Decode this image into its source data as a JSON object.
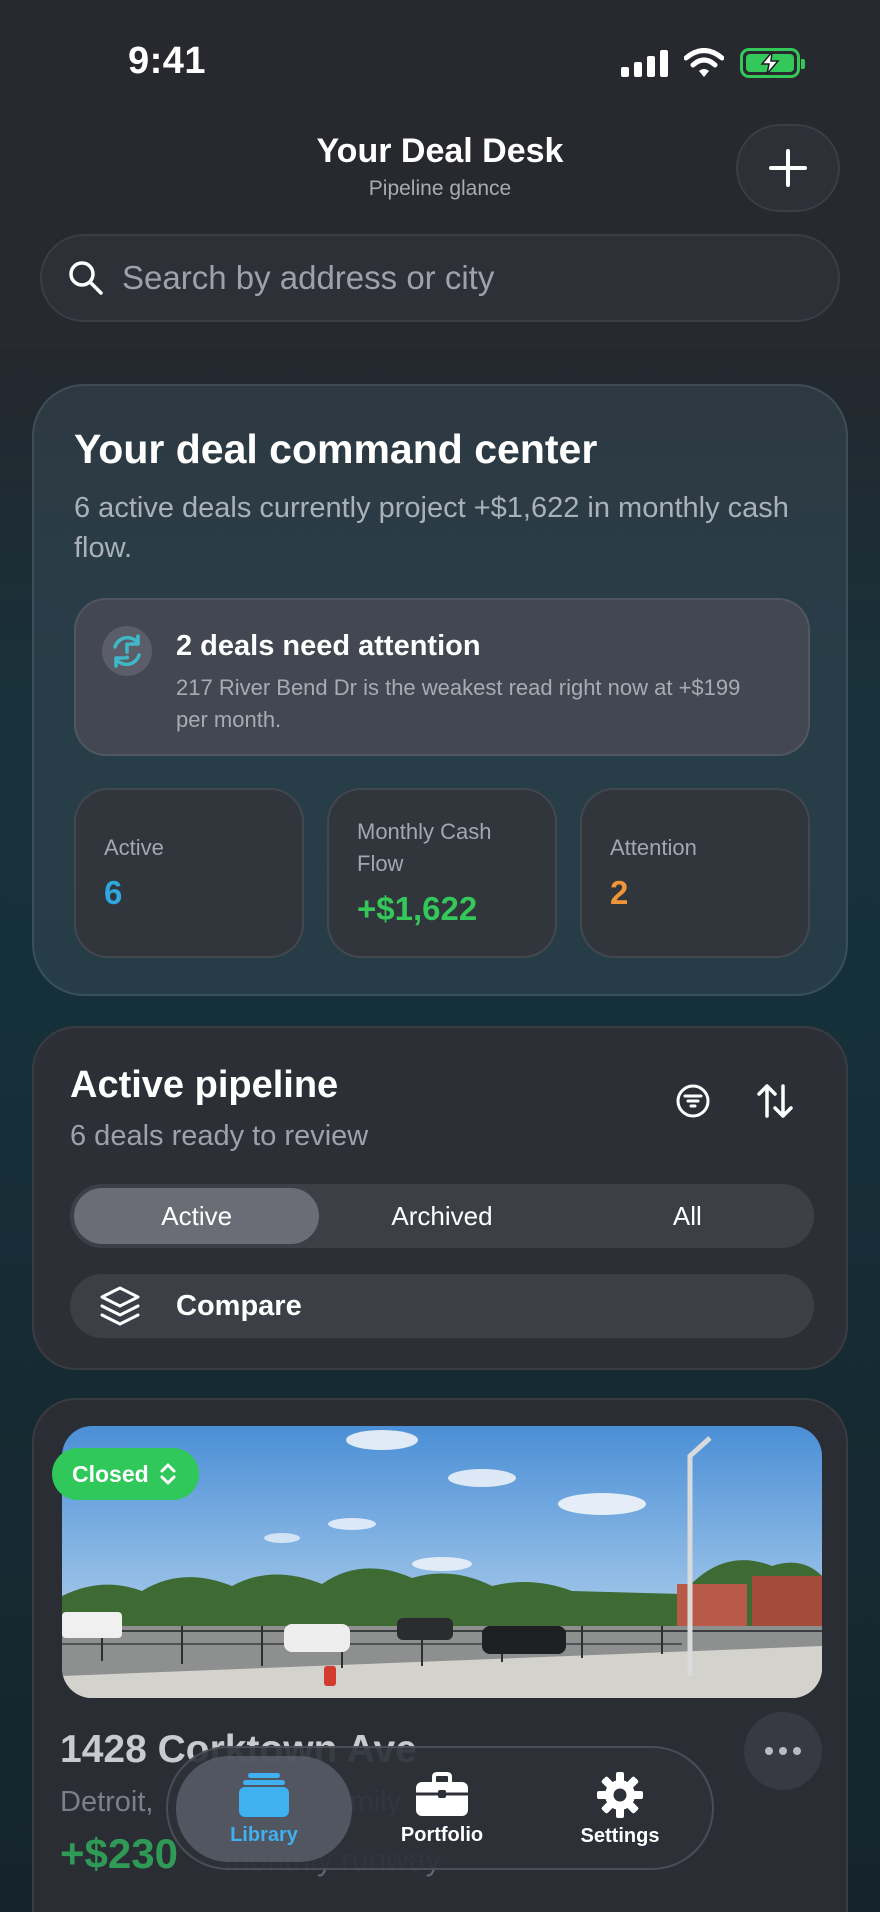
{
  "status_bar": {
    "time": "9:41"
  },
  "header": {
    "title": "Your Deal Desk",
    "subtitle": "Pipeline glance",
    "add_icon": "plus-icon"
  },
  "search": {
    "placeholder": "Search by address or city",
    "icon": "search-icon"
  },
  "command_center": {
    "title": "Your deal command center",
    "description": "6 active deals currently project +$1,622 in monthly cash flow.",
    "attention": {
      "icon": "alert-refresh-icon",
      "title": "2 deals need attention",
      "description": "217 River Bend Dr is the weakest read right now at +$199 per month."
    },
    "stats": [
      {
        "label": "Active",
        "value": "6",
        "color": "#2fa8e0"
      },
      {
        "label": "Monthly Cash Flow",
        "value": "+$1,622",
        "color": "#34c759"
      },
      {
        "label": "Attention",
        "value": "2",
        "color": "#f0953a"
      }
    ]
  },
  "pipeline": {
    "title": "Active pipeline",
    "subtitle": "6 deals ready to review",
    "filter_icon": "filter-icon",
    "sort_icon": "sort-icon",
    "segments": [
      "Active",
      "Archived",
      "All"
    ],
    "selected_segment": "Active",
    "compare_label": "Compare",
    "compare_icon": "layers-icon"
  },
  "deal": {
    "status": "Closed",
    "address": "1428 Corktown Ave",
    "location": "Detroit,",
    "location_suffix": "mily",
    "runway_value": "+$230",
    "runway_label": "monthly runway",
    "more_icon": "ellipsis-icon"
  },
  "tabbar": {
    "tabs": [
      {
        "label": "Library",
        "icon": "library-icon",
        "active": true
      },
      {
        "label": "Portfolio",
        "icon": "briefcase-icon",
        "active": false
      },
      {
        "label": "Settings",
        "icon": "gear-icon",
        "active": false
      }
    ]
  },
  "colors": {
    "accent": "#3fb0f0",
    "positive": "#34c759",
    "warning": "#f0953a",
    "closed": "#30c85a"
  }
}
